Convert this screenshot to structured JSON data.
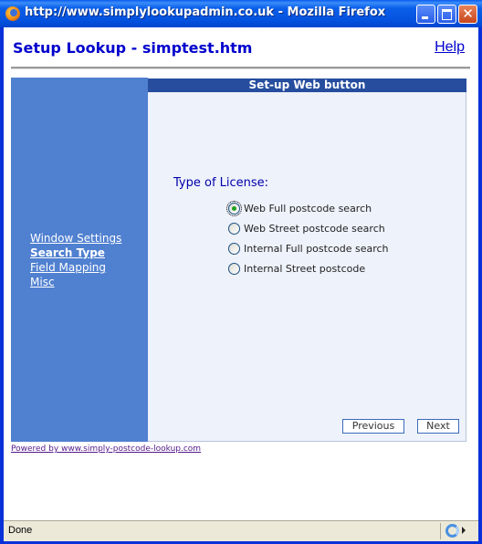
{
  "window": {
    "title": "http://www.simplylookupadmin.co.uk - Mozilla Firefox",
    "close_glyph": "✕"
  },
  "header": {
    "title": "Setup Lookup - simptest.htm",
    "help_label": "Help"
  },
  "sidebar": {
    "items": [
      {
        "label": "Window Settings",
        "active": false
      },
      {
        "label": "Search Type",
        "active": true
      },
      {
        "label": "Field Mapping",
        "active": false
      },
      {
        "label": "Misc",
        "active": false
      }
    ]
  },
  "panel": {
    "heading": "Set-up Web button",
    "license_label": "Type of License:",
    "options": [
      {
        "label": "Web Full postcode search",
        "checked": true
      },
      {
        "label": "Web Street postcode search",
        "checked": false
      },
      {
        "label": "Internal Full postcode search",
        "checked": false
      },
      {
        "label": "Internal Street postcode",
        "checked": false
      }
    ],
    "previous_label": "Previous",
    "next_label": "Next"
  },
  "footer": {
    "powered_by": "Powered by www.simply-postcode-lookup.com"
  },
  "statusbar": {
    "status": "Done"
  }
}
